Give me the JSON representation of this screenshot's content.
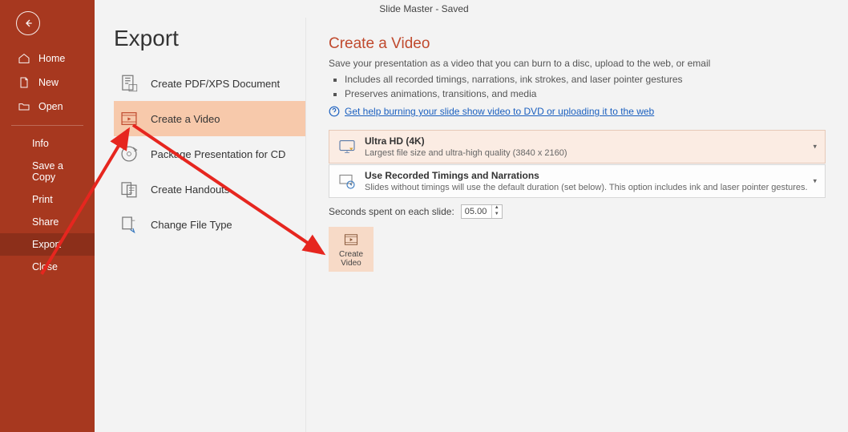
{
  "titlebar": "Slide Master  -  Saved",
  "page_title": "Export",
  "sidebar": {
    "home": "Home",
    "new": "New",
    "open": "Open",
    "info": "Info",
    "save_copy": "Save a Copy",
    "print": "Print",
    "share": "Share",
    "export": "Export",
    "close": "Close"
  },
  "export_options": {
    "pdf": "Create PDF/XPS Document",
    "video": "Create a Video",
    "package": "Package Presentation for CD",
    "handouts": "Create Handouts",
    "change_type": "Change File Type"
  },
  "detail": {
    "heading": "Create a Video",
    "intro": "Save your presentation as a video that you can burn to a disc, upload to the web, or email",
    "b1": "Includes all recorded timings, narrations, ink strokes, and laser pointer gestures",
    "b2": "Preserves animations, transitions, and media",
    "help": "Get help burning your slide show video to DVD or uploading it to the web",
    "quality_title": "Ultra HD (4K)",
    "quality_sub": "Largest file size and ultra-high quality (3840 x 2160)",
    "timing_title": "Use Recorded Timings and Narrations",
    "timing_sub": "Slides without timings will use the default duration (set below). This option includes ink and laser pointer gestures.",
    "seconds_label": "Seconds spent on each slide:",
    "seconds_value": "05.00",
    "create_btn": "Create Video"
  }
}
